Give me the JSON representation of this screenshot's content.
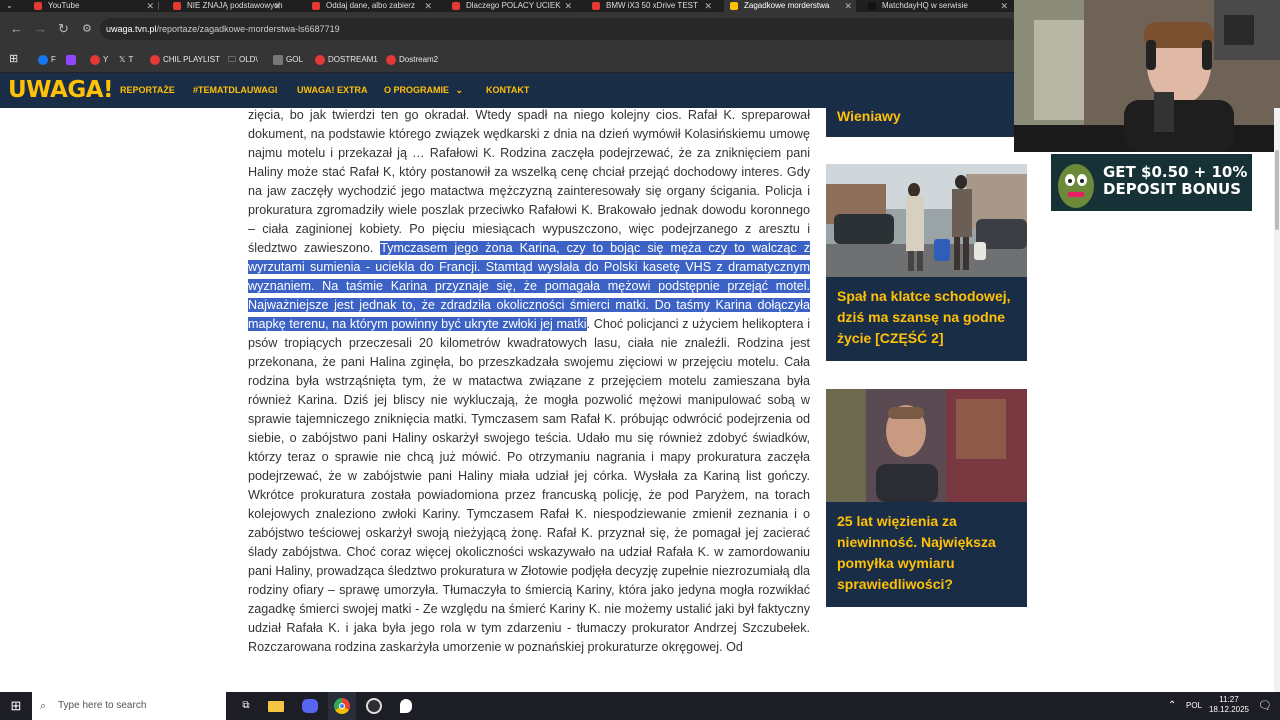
{
  "browser": {
    "tabs": [
      {
        "title": "YouTube",
        "active": false
      },
      {
        "title": "NIE ZNAJĄ podstawowych",
        "active": false
      },
      {
        "title": "Oddaj dane, albo zabierz",
        "active": false
      },
      {
        "title": "Dlaczego POLACY UCIEK",
        "active": false
      },
      {
        "title": "BMW iX3 50 xDrive TEST",
        "active": false
      },
      {
        "title": "Zagadkowe morderstwa",
        "active": true
      },
      {
        "title": "MatchdayHQ w serwisie",
        "active": false
      }
    ],
    "url_domain": "uwaga.tvn.pl",
    "url_path": "/reportaze/zagadkowe-morderstwa-ls6687719",
    "bookmarks": [
      "F",
      "Y",
      "T",
      "CHIL PLAYLIST",
      "OLD\\",
      "GOL",
      "DOSTREAM1",
      "Dostream2"
    ]
  },
  "site": {
    "logo": "UWAGA!",
    "nav": [
      "REPORTAŻE",
      "#TEMATDLAUWAGI",
      "UWAGA! EXTRA",
      "O PROGRAMIE",
      "KONTAKT"
    ]
  },
  "article": {
    "before": "zięcia, bo jak twierdzi ten go okradał. Wtedy spadł na niego kolejny cios. Rafał K. spreparował dokument, na podstawie którego związek wędkarski z dnia na dzień wymówił Kolasińskiemu umowę najmu motelu i przekazał ją … Rafałowi K. Rodzina zaczęła podejrzewać, że za zniknięciem pani Haliny może stać Rafał K, który postanowił za wszelką cenę chciał przejąć dochodowy interes. Gdy na jaw zaczęły wychodzić jego matactwa mężczyzną zainteresowały się organy ścigania. Policja i prokuratura zgromadziły wiele poszlak przeciwko Rafałowi K. Brakowało jednak dowodu koronnego – ciała zaginionej kobiety. Po pięciu miesiącach wypuszczono, więc podejrzanego z aresztu i śledztwo zawieszono.",
    "highlighted": "Tymczasem jego żona Karina, czy to bojąc się męża czy to walcząc z wyrzutami sumienia - uciekła do Francji. Stamtąd wysłała do Polski kasetę VHS z dramatycznym wyznaniem. Na taśmie Karina przyznaje się, że pomagała mężowi podstępnie przejąć motel. Najważniejsze jest jednak to, że zdradziła okoliczności śmierci matki. Do taśmy Karina dołączyła mapkę terenu, na którym powinny być ukryte zwłoki jej matki",
    "after": ". Choć policjanci z użyciem helikoptera i psów tropiących przeczesali 20 kilometrów kwadratowych lasu, ciała nie znaleźli. Rodzina jest przekonana, że pani Halina zginęła, bo przeszkadzała swojemu zięciowi w przejęciu motelu. Cała rodzina była wstrząśnięta tym, że w matactwa związane z przejęciem motelu zamieszana była również Karina. Dziś jej bliscy nie wykluczają, że mogła pozwolić mężowi manipulować sobą w sprawie tajemniczego zniknięcia matki. Tymczasem sam Rafał K. próbując odwrócić podejrzenia od siebie, o zabójstwo pani Haliny oskarżył swojego teścia. Udało mu się również zdobyć świadków, którzy teraz o sprawie nie chcą już mówić. Po otrzymaniu nagrania i mapy prokuratura zaczęła podejrzewać, że w zabójstwie pani Haliny miała udział jej córka. Wysłała za Kariną list gończy. Wkrótce prokuratura została powiadomiona przez francuską policję, że pod Paryżem, na torach kolejowych znaleziono zwłoki Kariny. Tymczasem Rafał K. niespodziewanie zmienił zeznania i o zabójstwo teściowej oskarżył swoją nieżyjącą żonę. Rafał K. przyznał się, że pomagał jej zacierać ślady zabójstwa. Choć coraz więcej okoliczności wskazywało na udział Rafała K. w zamordowaniu pani Haliny, prowadząca śledztwo prokuratura w Złotowie podjęła decyzję zupełnie niezrozumiałą dla rodziny ofiary – sprawę umorzyła. Tłumaczyła to śmiercią Kariny, która jako jedyna mogła rozwikłać zagadkę śmierci swojej matki - Ze względu na śmierć Kariny K. nie możemy ustalić jaki był faktyczny udział Rafała K. i jaka była jego rola w tym zdarzeniu - tłumaczy prokurator Andrzej Szczubełek. Rozczarowana rodzina zaskarżyła umorzenie w poznańskiej prokuraturze okręgowej. Od"
  },
  "sidebar": {
    "card0_title": "Wieniawy",
    "card1_title": "Spał na klatce schodowej, dziś ma szansę na godne życie [CZĘŚĆ 2]",
    "card2_title": "25 lat więzienia za niewinność. Największa pomyłka wymiaru sprawiedliwości?"
  },
  "ad": {
    "text_line1": "GET $0.50 + 10%",
    "text_line2": "DEPOSIT BONUS"
  },
  "taskbar": {
    "search_placeholder": "Type here to search",
    "lang": "POL",
    "time": "11:27",
    "date": "18.12.2025"
  },
  "colors": {
    "nav_bg": "#1a2d47",
    "accent": "#ffc107",
    "highlight": "#3b62c4"
  }
}
